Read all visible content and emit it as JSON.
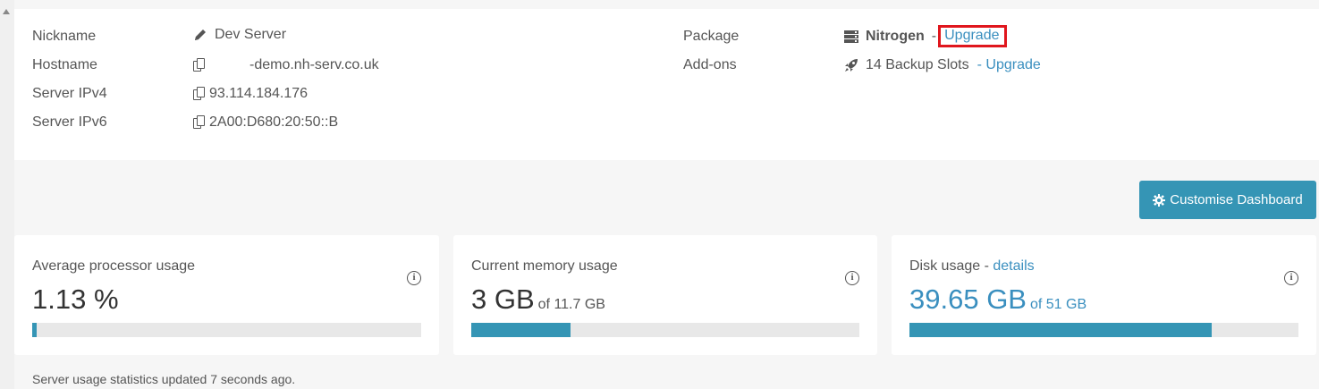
{
  "server": {
    "nickname_label": "Nickname",
    "nickname_value": "Dev Server",
    "hostname_label": "Hostname",
    "hostname_value": "-demo.nh-serv.co.uk",
    "ipv4_label": "Server IPv4",
    "ipv4_value": "93.114.184.176",
    "ipv6_label": "Server IPv6",
    "ipv6_value": "2A00:D680:20:50::B"
  },
  "package": {
    "label": "Package",
    "name": "Nitrogen",
    "separator": "-",
    "upgrade_label": "Upgrade",
    "icon": "server-icon"
  },
  "addons": {
    "label": "Add-ons",
    "value": "14 Backup Slots",
    "upgrade_label": "- Upgrade",
    "icon": "rocket-icon"
  },
  "toolbar": {
    "customise_label": "Customise Dashboard",
    "icon": "gear-icon"
  },
  "cards": {
    "cpu": {
      "title": "Average processor usage",
      "value": "1.13 %",
      "fill_fraction": 0.0113
    },
    "memory": {
      "title": "Current memory usage",
      "value": "3 GB",
      "of_text": "of 11.7 GB",
      "fill_fraction": 0.2564
    },
    "disk": {
      "title": "Disk usage - ",
      "details_link": "details",
      "value": "39.65 GB",
      "of_text": "of 51 GB",
      "fill_fraction": 0.7775
    },
    "info_glyph": "i"
  },
  "footer": {
    "status_text": "Server usage statistics updated 7 seconds ago."
  },
  "colors": {
    "accent": "#3595b5",
    "link": "#3a8fbf",
    "highlight": "#e0161d"
  }
}
